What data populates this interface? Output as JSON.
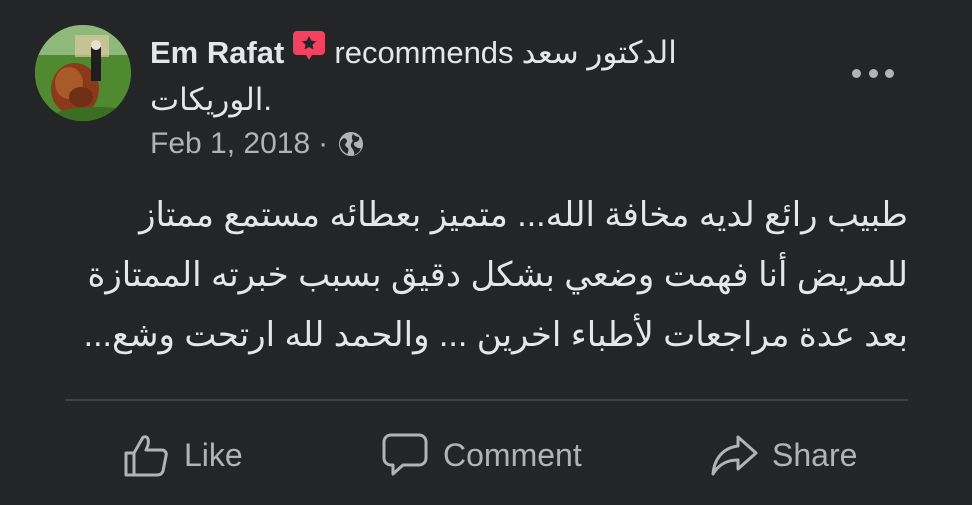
{
  "header": {
    "author": "Em Rafat",
    "recommends_word": "recommends",
    "page_name_line1": "الدكتور سعد",
    "page_name_line2": ".الوريكات"
  },
  "meta": {
    "date": "Feb 1, 2018",
    "separator": "·",
    "audience_icon": "globe-icon"
  },
  "body": {
    "lines": [
      "طبيب رائع لديه مخافة الله... متميز بعطائه مستمع ممتاز",
      "للمريض أنا فهمت وضعي بشكل دقيق بسبب خبرته الممتازة",
      "بعد عدة مراجعات لأطباء اخرين ... والحمد لله ارتحت وشع..."
    ]
  },
  "actions": {
    "like_label": "Like",
    "comment_label": "Comment",
    "share_label": "Share"
  },
  "colors": {
    "background": "#242527",
    "primary_text": "#e4e6eb",
    "secondary_text": "#b0b3b8",
    "recommend_badge": "#f3425f",
    "divider": "#3e4042"
  },
  "icons": {
    "recommend": "recommend-badge-icon",
    "more": "more-horizontal-icon",
    "like": "thumbs-up-icon",
    "comment": "speech-bubble-icon",
    "share": "share-arrow-icon"
  }
}
